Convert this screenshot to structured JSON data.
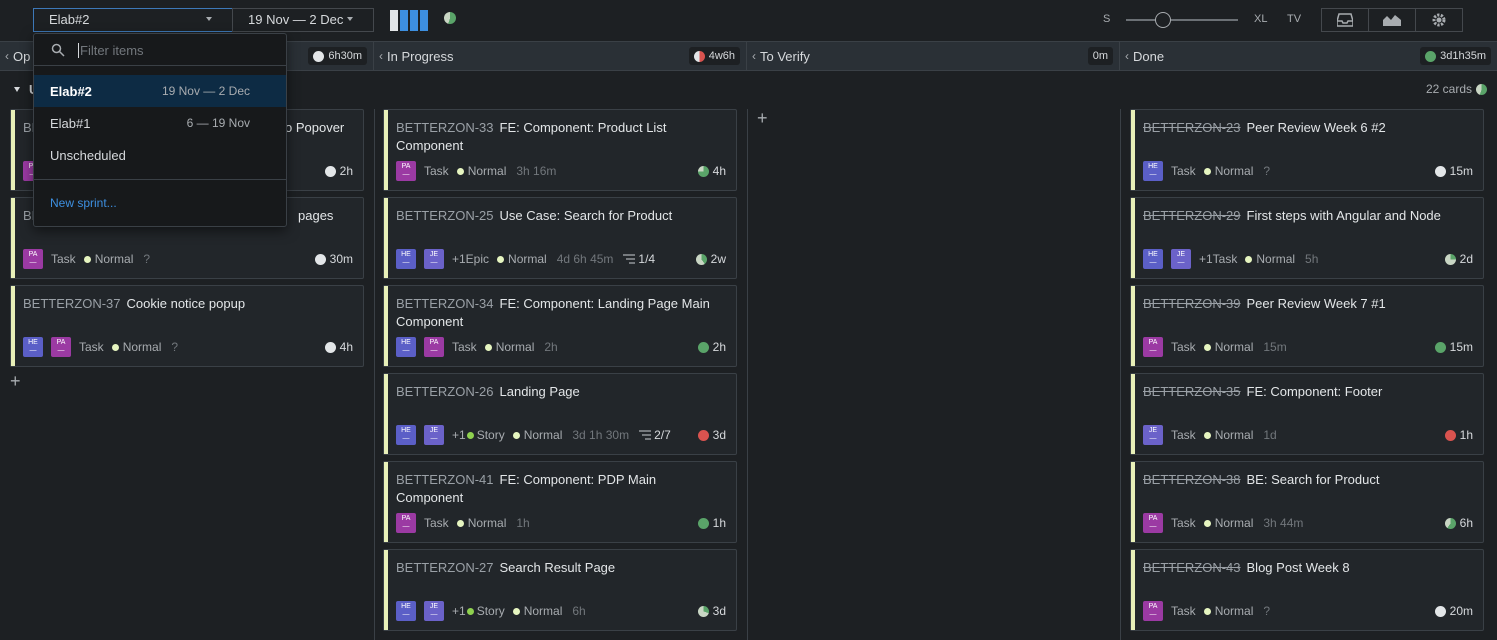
{
  "topbar": {
    "sprint_value": "Elab#2",
    "date_range": "19 Nov — 2 Dec",
    "size_s": "S",
    "size_xl": "XL",
    "size_tv": "TV",
    "icons": [
      "inbox-icon",
      "chart-icon",
      "settings-icon"
    ]
  },
  "columns": [
    {
      "label": "Op",
      "time": "6h30m",
      "time_icon": "circle-white"
    },
    {
      "label": "In Progress",
      "time": "4w6h",
      "time_icon": "pie-red"
    },
    {
      "label": "To Verify",
      "time": "0m"
    },
    {
      "label": "Done",
      "time": "3d1h35m",
      "time_icon": "circle-green"
    }
  ],
  "swimlane": {
    "letter": "U",
    "cards_count": "22 cards"
  },
  "open_cards": [
    {
      "key": "BE",
      "title": "o Popover",
      "tags": [
        "PA"
      ],
      "est": "2h"
    },
    {
      "key": "BE",
      "title": "pages",
      "tags": [
        "PA"
      ],
      "type": "Task",
      "priority": "Normal",
      "spent": "?",
      "est": "30m"
    },
    {
      "key": "BETTERZON-37",
      "title": "Cookie notice popup",
      "tags": [
        "HE",
        "PA"
      ],
      "type": "Task",
      "priority": "Normal",
      "spent": "?",
      "est": "4h"
    }
  ],
  "progress_cards": [
    {
      "key": "BETTERZON-33",
      "title": "FE: Component: Product List Component",
      "tags": [
        "PA"
      ],
      "type": "Task",
      "priority": "Normal",
      "spent": "3h 16m",
      "est": "4h"
    },
    {
      "key": "BETTERZON-25",
      "title": "Use Case: Search for Product",
      "tags": [
        "HE",
        "JE"
      ],
      "type": "+1Epic",
      "priority": "Normal",
      "spent": "4d 6h 45m",
      "sub": "1/4",
      "est": "2w"
    },
    {
      "key": "BETTERZON-34",
      "title": "FE: Component: Landing Page Main Component",
      "tags": [
        "HE",
        "PA"
      ],
      "type": "Task",
      "priority": "Normal",
      "spent": "2h",
      "est": "2h"
    },
    {
      "key": "BETTERZON-26",
      "title": "Landing Page",
      "tags": [
        "HE",
        "JE"
      ],
      "type": "Story",
      "extra": "+1",
      "priority": "Normal",
      "spent": "3d 1h 30m",
      "sub": "2/7",
      "est": "3d"
    },
    {
      "key": "BETTERZON-41",
      "title": "FE: Component: PDP Main Component",
      "tags": [
        "PA"
      ],
      "type": "Task",
      "priority": "Normal",
      "spent": "1h",
      "est": "1h"
    },
    {
      "key": "BETTERZON-27",
      "title": "Search Result Page",
      "tags": [
        "HE",
        "JE"
      ],
      "type": "Story",
      "extra": "+1",
      "priority": "Normal",
      "spent": "6h",
      "est": "3d"
    }
  ],
  "done_cards": [
    {
      "key": "BETTERZON-23",
      "title": "Peer Review Week 6 #2",
      "tags": [
        "HE"
      ],
      "type": "Task",
      "priority": "Normal",
      "spent": "?",
      "est": "15m"
    },
    {
      "key": "BETTERZON-29",
      "title": "First steps with Angular and Node",
      "tags": [
        "HE",
        "JE"
      ],
      "type": "+1Task",
      "priority": "Normal",
      "spent": "5h",
      "est": "2d"
    },
    {
      "key": "BETTERZON-39",
      "title": "Peer Review Week 7 #1",
      "tags": [
        "PA"
      ],
      "type": "Task",
      "priority": "Normal",
      "spent": "15m",
      "est": "15m"
    },
    {
      "key": "BETTERZON-35",
      "title": "FE: Component: Footer",
      "tags": [
        "JE"
      ],
      "type": "Task",
      "priority": "Normal",
      "spent": "1d",
      "est": "1h"
    },
    {
      "key": "BETTERZON-38",
      "title": "BE: Search for Product",
      "tags": [
        "PA"
      ],
      "type": "Task",
      "priority": "Normal",
      "spent": "3h 44m",
      "est": "6h"
    },
    {
      "key": "BETTERZON-43",
      "title": "Blog Post Week 8",
      "tags": [
        "PA"
      ],
      "type": "Task",
      "priority": "Normal",
      "spent": "?",
      "est": "20m"
    }
  ],
  "dropdown": {
    "placeholder": "Filter items",
    "items": [
      {
        "label": "Elab#2",
        "dates": "19 Nov — 2 Dec"
      },
      {
        "label": "Elab#1",
        "dates": "6 — 19 Nov"
      },
      {
        "label": "Unscheduled",
        "dates": ""
      }
    ],
    "new_sprint": "New sprint..."
  }
}
